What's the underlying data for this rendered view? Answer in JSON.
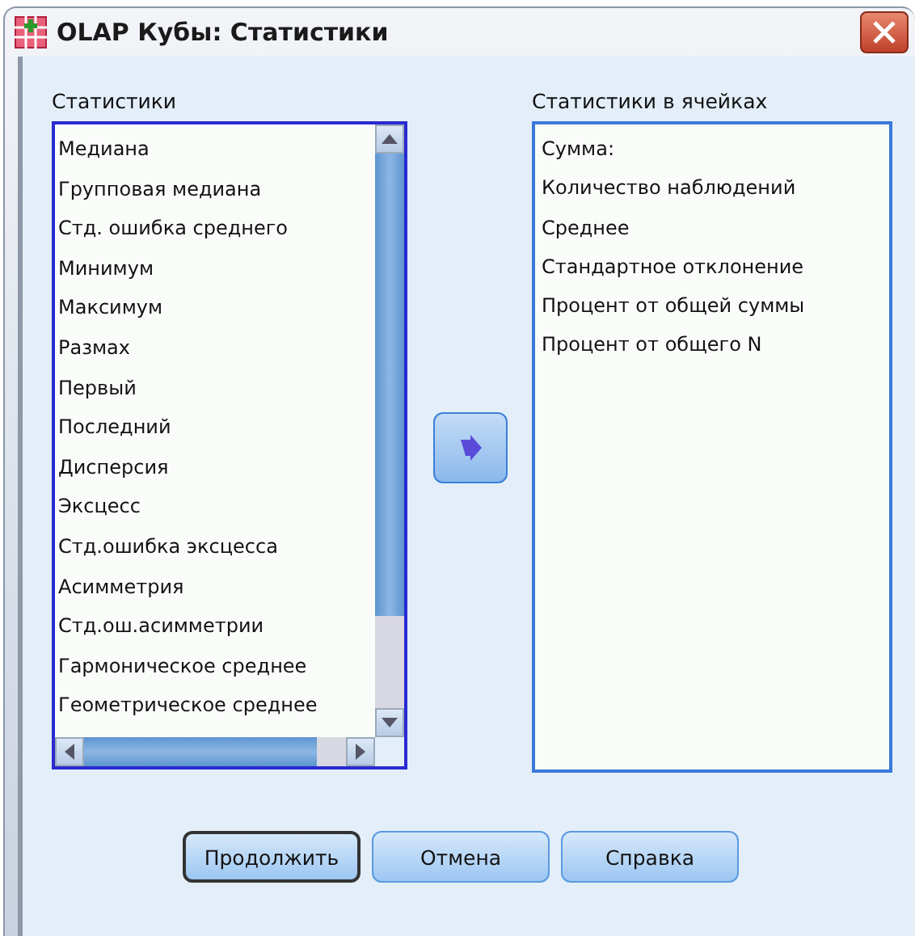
{
  "window": {
    "title": "OLAP Кубы: Статистики"
  },
  "statistics": {
    "label": "Статистики",
    "items": [
      "Медиана",
      "Групповая медиана",
      "Стд. ошибка среднего",
      "Минимум",
      "Максимум",
      "Размах",
      "Первый",
      "Последний",
      "Дисперсия",
      "Эксцесс",
      "Стд.ошибка эксцесса",
      "Асимметрия",
      "Стд.ош.асимметрии",
      "Гармоническое среднее",
      "Геометрическое среднее"
    ]
  },
  "cell_statistics": {
    "label": "Статистики в ячейках",
    "items": [
      "Сумма:",
      "Количество наблюдений",
      "Среднее",
      "Стандартное отклонение",
      "Процент от общей суммы",
      "Процент от общего N"
    ]
  },
  "buttons": [
    {
      "label": "Продолжить",
      "default": true
    },
    {
      "label": "Отмена",
      "default": false
    },
    {
      "label": "Справка",
      "default": false
    }
  ]
}
